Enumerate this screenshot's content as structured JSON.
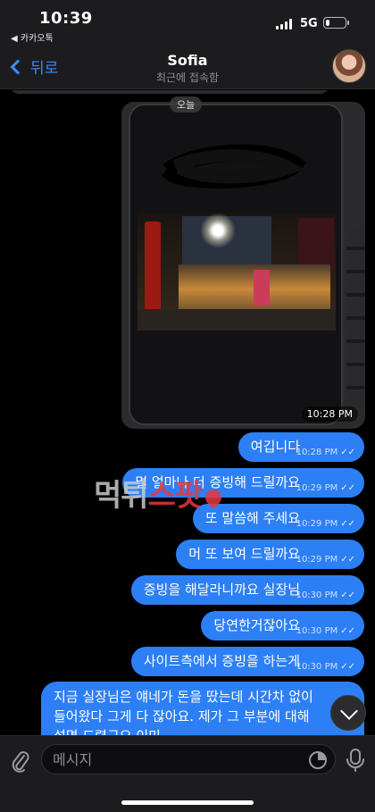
{
  "status_bar": {
    "time": "10:39",
    "back_app": "◀ 카카오톡",
    "network": "5G",
    "battery_level": 0.2
  },
  "nav": {
    "back_label": "뒤로",
    "contact_name": "Sofia",
    "contact_status": "최근에 접속함"
  },
  "chat": {
    "date_divider": "오늘",
    "photo_message": {
      "time": "10:28 PM",
      "watermark_gray": "먹튀",
      "watermark_red": "스팟"
    },
    "messages": [
      {
        "text": "여깁니다",
        "time": "10:28 PM"
      },
      {
        "text": "멀 얼마나 더 증빙해 드릴까요",
        "time": "10:29 PM"
      },
      {
        "text": "또 말씀해 주세요",
        "time": "10:29 PM"
      },
      {
        "text": "머 또 보여 드릴까요",
        "time": "10:29 PM"
      },
      {
        "text": "증빙을 해달라니까요 실장님",
        "time": "10:30 PM"
      },
      {
        "text": "당연한거잖아요",
        "time": "10:30 PM"
      },
      {
        "text": "사이트측에서 증빙을 하는게",
        "time": "10:30 PM"
      }
    ],
    "last_message": {
      "line1": "지금 실장님은 얘네가 돈을 땄는데 시간차 없이",
      "line2": "들어왔다 그게 다 잖아요. 제가 그 부분에 대해",
      "line3": "설명 드렸구요 이미"
    }
  },
  "input": {
    "placeholder": "메시지"
  },
  "colors": {
    "bubble": "#2d7ff5",
    "accent": "#3a8bff",
    "background": "#000000"
  },
  "icons": [
    "back-chevron-icon",
    "paperclip-icon",
    "sticker-icon",
    "microphone-icon",
    "scroll-down-chevron-icon",
    "read-ticks-icon"
  ]
}
